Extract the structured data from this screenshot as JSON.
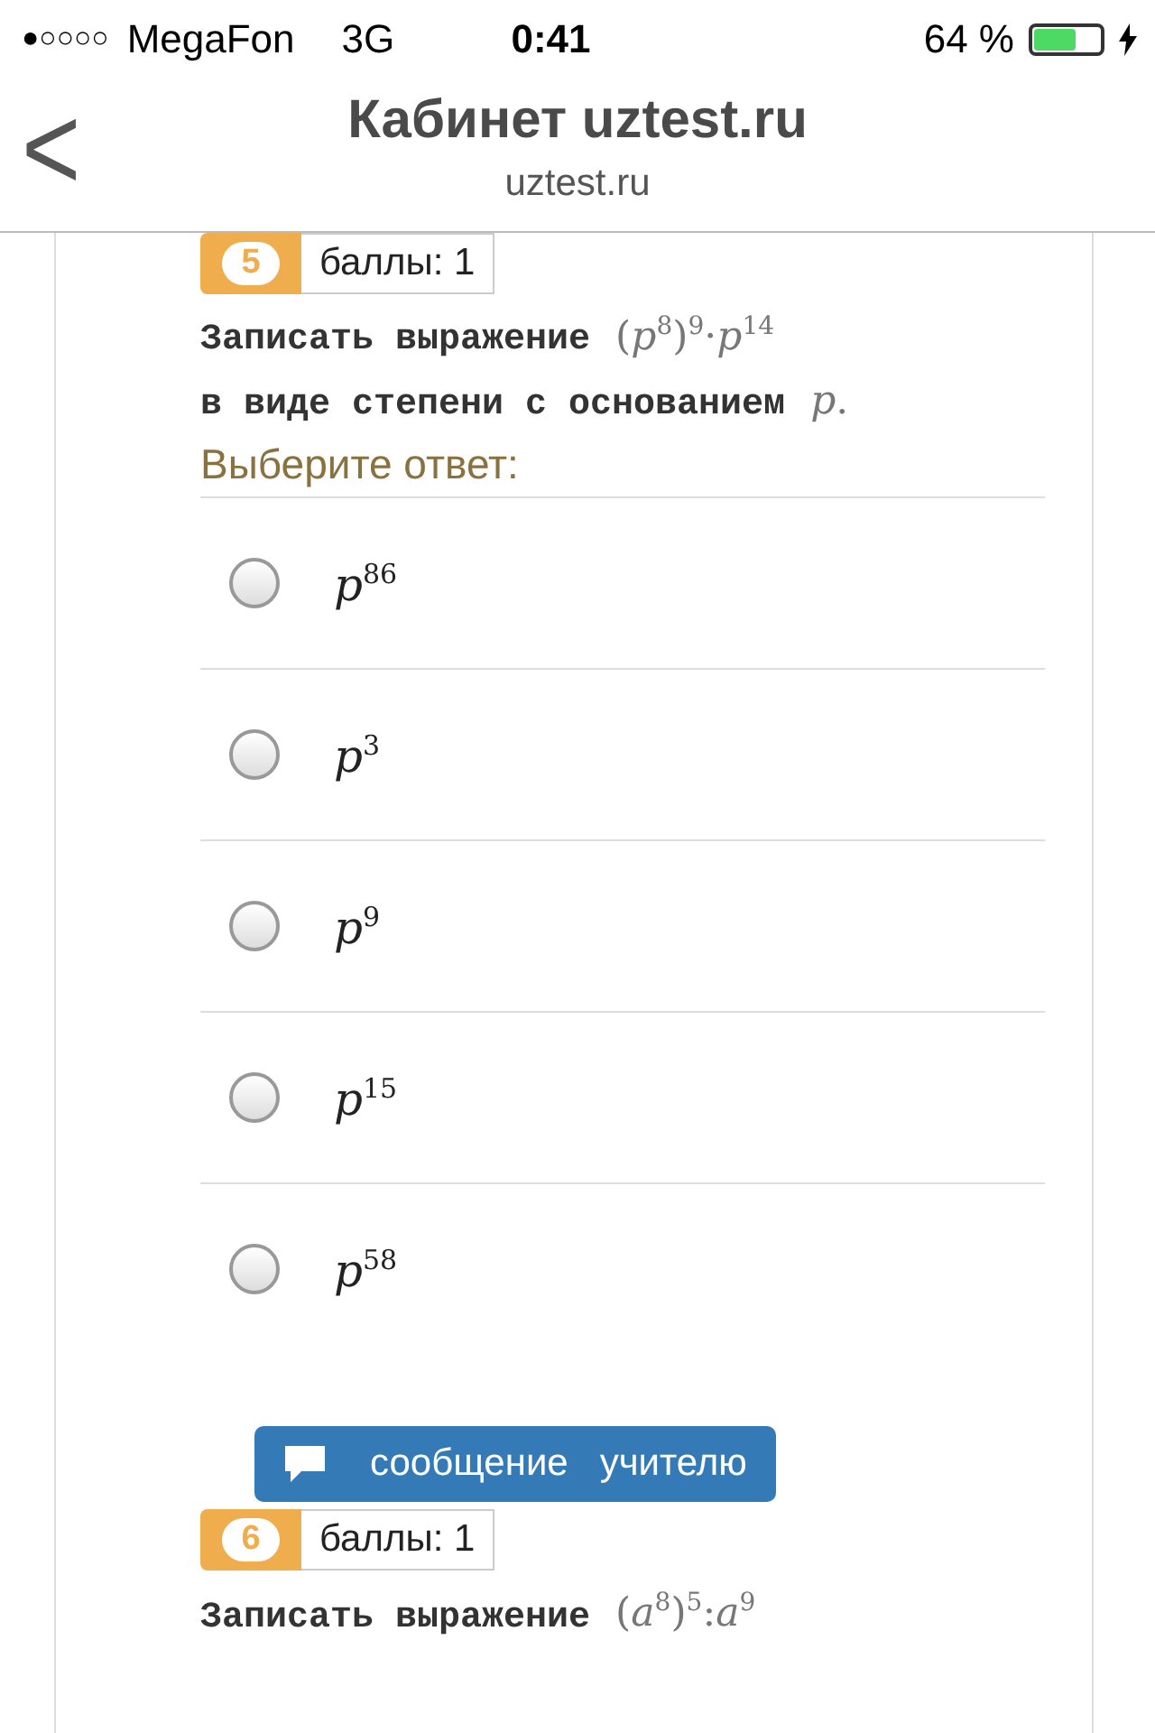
{
  "status_bar": {
    "signal": "●○○○○",
    "carrier": "MegaFon",
    "network": "3G",
    "time": "0:41",
    "battery_text": "64 %",
    "charging": true
  },
  "nav": {
    "back": "<",
    "title": "Кабинет uztest.ru",
    "subtitle": "uztest.ru"
  },
  "questions": [
    {
      "number": "5",
      "points": "баллы: 1",
      "lines": [
        {
          "text": "Записать выражение",
          "math": "(*p*$^{8}$)$^{9}$·*p*$^{14}$"
        },
        {
          "text": "в виде степени с основанием",
          "math": "*p*."
        }
      ],
      "prompt": "Выберите ответ:",
      "options": [
        {
          "label": "*p*$^{86}$",
          "selected": false
        },
        {
          "label": "*p*$^{3}$",
          "selected": false
        },
        {
          "label": "*p*$^{9}$",
          "selected": false
        },
        {
          "label": "*p*$^{15}$",
          "selected": false
        },
        {
          "label": "*p*$^{58}$",
          "selected": false
        }
      ],
      "message_button": "сообщение   учителю"
    },
    {
      "number": "6",
      "points": "баллы: 1",
      "lines": [
        {
          "text": "Записать выражение",
          "math": "(*a*$^{8}$)$^{5}$:*a*$^{9}$"
        }
      ]
    }
  ]
}
